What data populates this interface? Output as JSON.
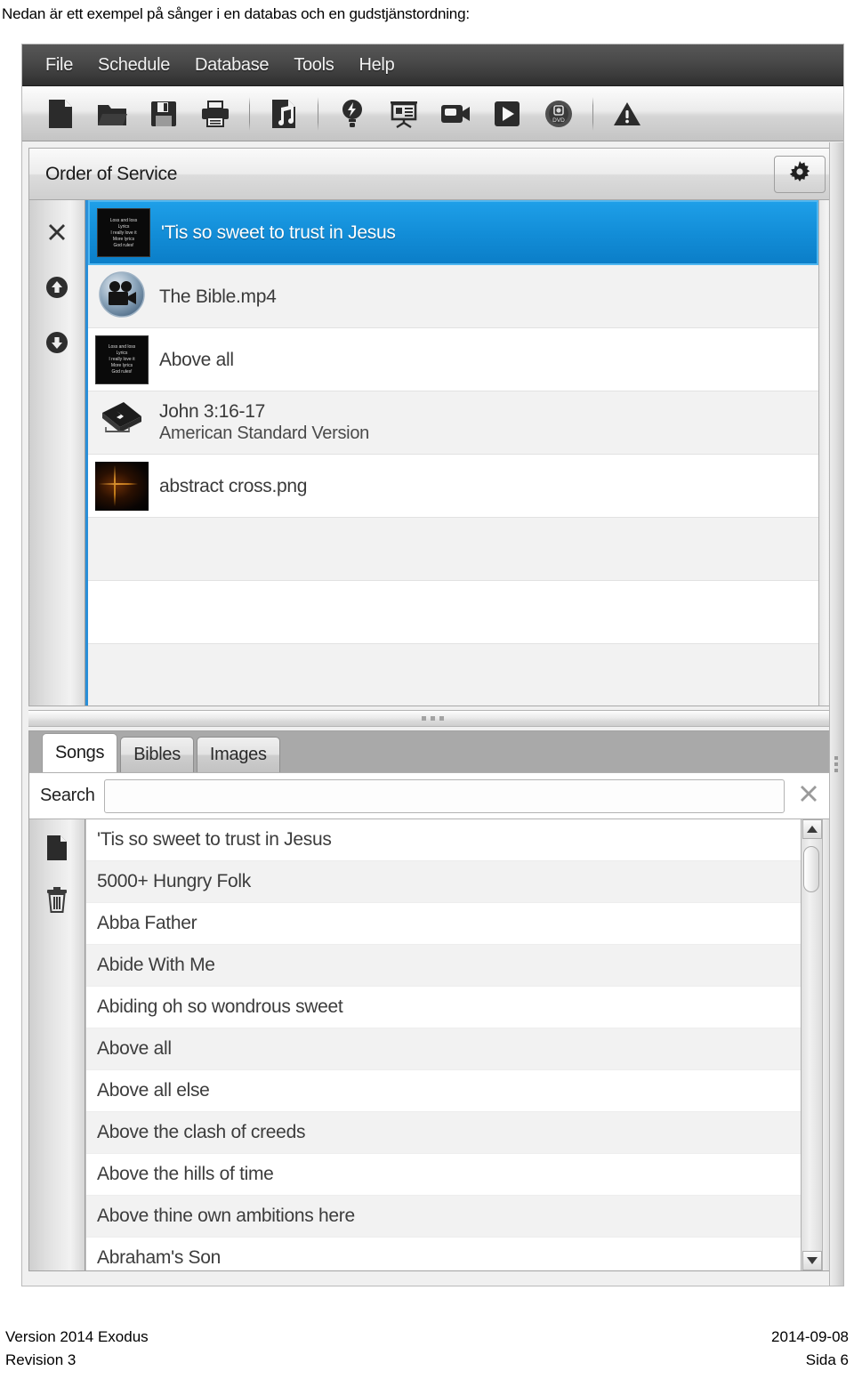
{
  "caption": "Nedan är ett exempel på sånger i en databas och en gudstjänstordning:",
  "menubar": {
    "items": [
      {
        "label": "File"
      },
      {
        "label": "Schedule"
      },
      {
        "label": "Database"
      },
      {
        "label": "Tools"
      },
      {
        "label": "Help"
      }
    ]
  },
  "toolbar": {
    "buttons": [
      {
        "icon": "new-document-icon",
        "name": "new-button"
      },
      {
        "icon": "open-folder-icon",
        "name": "open-button"
      },
      {
        "icon": "save-floppy-icon",
        "name": "save-button"
      },
      {
        "icon": "print-icon",
        "name": "print-button"
      },
      {
        "icon": "music-note-file-icon",
        "name": "add-song-button"
      },
      {
        "icon": "lightbulb-icon",
        "name": "quick-idea-button"
      },
      {
        "icon": "presentation-board-icon",
        "name": "presentation-button"
      },
      {
        "icon": "video-camera-icon",
        "name": "video-button"
      },
      {
        "icon": "play-icon",
        "name": "play-button"
      },
      {
        "icon": "dvd-disc-icon",
        "name": "dvd-button"
      },
      {
        "icon": "warning-triangle-icon",
        "name": "alert-button"
      }
    ]
  },
  "order_of_service": {
    "title": "Order of Service",
    "gear_icon": "gear-icon",
    "sidebar": [
      {
        "icon": "close-x-icon",
        "name": "remove-item-button"
      },
      {
        "icon": "arrow-up-circle-icon",
        "name": "move-up-button"
      },
      {
        "icon": "arrow-down-circle-icon",
        "name": "move-down-button"
      }
    ],
    "thumb_lyrics": [
      "Loss and loss",
      "Lyrics",
      "I really love it",
      "More lyrics",
      "God rules!"
    ],
    "items": [
      {
        "label": "'Tis so sweet to trust in Jesus",
        "sub": "",
        "thumb": "lyric-slide",
        "selected": true
      },
      {
        "label": "The Bible.mp4",
        "sub": "",
        "thumb": "video-icon",
        "selected": false
      },
      {
        "label": "Above all",
        "sub": "",
        "thumb": "lyric-slide",
        "selected": false
      },
      {
        "label": "John 3:16-17",
        "sub": "American Standard Version",
        "thumb": "bible-book-icon",
        "selected": false
      },
      {
        "label": "abstract cross.png",
        "sub": "",
        "thumb": "image-preview",
        "selected": false
      }
    ],
    "empty_rows": 4
  },
  "library": {
    "tabs": [
      {
        "label": "Songs",
        "active": true
      },
      {
        "label": "Bibles",
        "active": false
      },
      {
        "label": "Images",
        "active": false
      }
    ],
    "search": {
      "label": "Search",
      "value": "",
      "placeholder": "",
      "clear_icon": "clear-x-icon"
    },
    "sidebar": [
      {
        "icon": "new-document-icon",
        "name": "new-song-button"
      },
      {
        "icon": "trash-icon",
        "name": "delete-song-button"
      }
    ],
    "songs": [
      "'Tis so sweet to trust in Jesus",
      "5000+ Hungry Folk",
      "Abba Father",
      "Abide With Me",
      "Abiding oh so wondrous sweet",
      "Above all",
      "Above all else",
      "Above the clash of creeds",
      "Above the hills of time",
      "Above thine own ambitions here",
      "Abraham's Son"
    ]
  },
  "footer": {
    "version": "Version 2014 Exodus",
    "date": "2014-09-08",
    "revision": "Revision 3",
    "page": "Sida 6"
  },
  "colors": {
    "selection_blue": "#138ed8",
    "menubar_dark": "#3b3b3b",
    "accent_border": "#2a8fd8"
  }
}
